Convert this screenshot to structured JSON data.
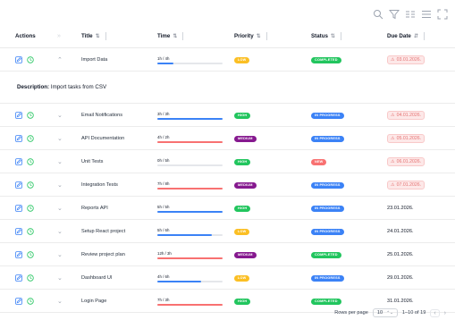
{
  "toolbar": {
    "icons": [
      "search-icon",
      "filter-icon",
      "columns-icon",
      "density-icon",
      "fullscreen-icon"
    ]
  },
  "headers": {
    "actions": "Actions",
    "expand": "»",
    "title": "Title",
    "time": "Time",
    "priority": "Priority",
    "status": "Status",
    "due": "Due Date",
    "sort_icon": "⇅",
    "due_sort_icon": "⇵"
  },
  "colors": {
    "low": "#fbbf24",
    "high": "#22c55e",
    "medium": "#86198f",
    "completed": "#22c55e",
    "in_progress": "#3b82f6",
    "new": "#f87171",
    "bar_ok": "#3b82f6",
    "bar_over": "#f87171"
  },
  "description": {
    "label": "Description:",
    "text": "Import tasks from CSV"
  },
  "rows": [
    {
      "title": "Import Data",
      "time": "1h / 4h",
      "progress": 0.25,
      "over": false,
      "priority": "LOW",
      "pkey": "low",
      "status": "COMPLETED",
      "skey": "completed",
      "due": "03.01.2026.",
      "overdue": true,
      "expanded": true
    },
    {
      "title": "Email Notifications",
      "time": "3h / 3h",
      "progress": 1.0,
      "over": false,
      "priority": "HIGH",
      "pkey": "high",
      "status": "IN PROGRESS",
      "skey": "in_progress",
      "due": "04.01.2026.",
      "overdue": true,
      "expanded": false
    },
    {
      "title": "API Documentation",
      "time": "4h / 2h",
      "progress": 1.0,
      "over": true,
      "priority": "MEDIUM",
      "pkey": "medium",
      "status": "IN PROGRESS",
      "skey": "in_progress",
      "due": "05.01.2026.",
      "overdue": true,
      "expanded": false
    },
    {
      "title": "Unit Tests",
      "time": "0h / 5h",
      "progress": 0.0,
      "over": false,
      "priority": "HIGH",
      "pkey": "high",
      "status": "NEW",
      "skey": "new",
      "due": "06.01.2026.",
      "overdue": true,
      "expanded": false
    },
    {
      "title": "Integration Tests",
      "time": "7h / 8h",
      "progress": 1.0,
      "over": true,
      "priority": "MEDIUM",
      "pkey": "medium",
      "status": "IN PROGRESS",
      "skey": "in_progress",
      "due": "07.01.2026.",
      "overdue": true,
      "expanded": false
    },
    {
      "title": "Reports API",
      "time": "5h / 5h",
      "progress": 1.0,
      "over": false,
      "priority": "HIGH",
      "pkey": "high",
      "status": "IN PROGRESS",
      "skey": "in_progress",
      "due": "23.01.2026.",
      "overdue": false,
      "expanded": false
    },
    {
      "title": "Setup React project",
      "time": "5h / 6h",
      "progress": 0.83,
      "over": false,
      "priority": "LOW",
      "pkey": "low",
      "status": "IN PROGRESS",
      "skey": "in_progress",
      "due": "24.01.2026.",
      "overdue": false,
      "expanded": false
    },
    {
      "title": "Review project plan",
      "time": "12h / 3h",
      "progress": 1.0,
      "over": true,
      "priority": "MEDIUM",
      "pkey": "medium",
      "status": "COMPLETED",
      "skey": "completed",
      "due": "25.01.2026.",
      "overdue": false,
      "expanded": false
    },
    {
      "title": "Dashboard UI",
      "time": "4h / 6h",
      "progress": 0.67,
      "over": false,
      "priority": "LOW",
      "pkey": "low",
      "status": "IN PROGRESS",
      "skey": "in_progress",
      "due": "29.01.2026.",
      "overdue": false,
      "expanded": false
    },
    {
      "title": "Login Page",
      "time": "7h / 3h",
      "progress": 1.0,
      "over": true,
      "priority": "HIGH",
      "pkey": "high",
      "status": "COMPLETED",
      "skey": "completed",
      "due": "31.01.2026.",
      "overdue": false,
      "expanded": false
    }
  ],
  "footer": {
    "rows_per_page_label": "Rows per page",
    "rows_per_page_value": "10",
    "range": "1–10 of 19",
    "prev": "‹",
    "next": "›"
  }
}
